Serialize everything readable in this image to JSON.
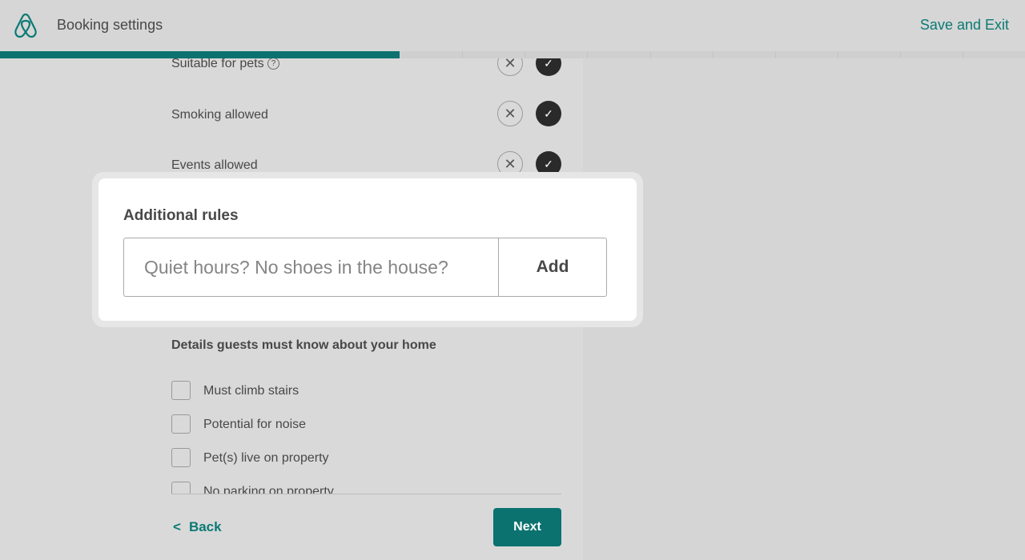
{
  "header": {
    "title": "Booking settings",
    "save_exit": "Save and Exit",
    "logo_icon": "airbnb-logo-icon"
  },
  "progress": {
    "percent": 39,
    "segments": 14,
    "color": "#0b7270"
  },
  "rules": [
    {
      "label": "Suitable for pets",
      "has_help": true,
      "value": "yes"
    },
    {
      "label": "Smoking allowed",
      "value": "yes"
    },
    {
      "label": "Events allowed",
      "value": "yes"
    }
  ],
  "modal": {
    "title": "Additional rules",
    "placeholder": "Quiet hours? No shoes in the house?",
    "add_label": "Add"
  },
  "details": {
    "title": "Details guests must know about your home",
    "items": [
      {
        "label": "Must climb stairs",
        "checked": false
      },
      {
        "label": "Potential for noise",
        "checked": false
      },
      {
        "label": "Pet(s) live on property",
        "checked": false
      },
      {
        "label": "No parking on property",
        "checked": false
      }
    ]
  },
  "footer": {
    "back": "Back",
    "next": "Next"
  },
  "colors": {
    "accent": "#0b7a75"
  }
}
